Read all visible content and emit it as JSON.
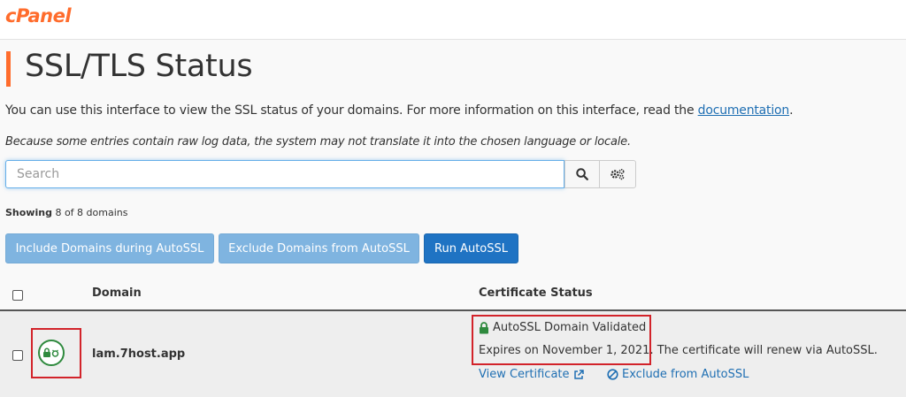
{
  "app": {
    "logo_text": "cPanel"
  },
  "page": {
    "title": "SSL/TLS Status",
    "intro_text": "You can use this interface to view the SSL status of your domains. For more information on this interface, read the ",
    "intro_link": "documentation",
    "intro_end": ".",
    "notice": "Because some entries contain raw log data, the system may not translate it into the chosen language or locale."
  },
  "search": {
    "placeholder": "Search",
    "value": ""
  },
  "showing": {
    "label": "Showing",
    "text": "8 of 8 domains"
  },
  "actions": {
    "include": "Include Domains during AutoSSL",
    "exclude": "Exclude Domains from AutoSSL",
    "run": "Run AutoSSL"
  },
  "table": {
    "columns": {
      "domain": "Domain",
      "status": "Certificate Status"
    },
    "rows": [
      {
        "domain": "lam.7host.app",
        "status_title": "AutoSSL Domain Validated",
        "expires": "Expires on November 1, 2021.",
        "renew_note": " The certificate will renew via AutoSSL.",
        "view_link": "View Certificate",
        "exclude_link": "Exclude from AutoSSL"
      }
    ]
  },
  "colors": {
    "brand": "#ff6c2c",
    "primary": "#1f73c3",
    "primary_light": "#7fb4e0",
    "valid_green": "#2f8a3e",
    "highlight_red": "#d2232a",
    "link": "#1f6fb3"
  }
}
